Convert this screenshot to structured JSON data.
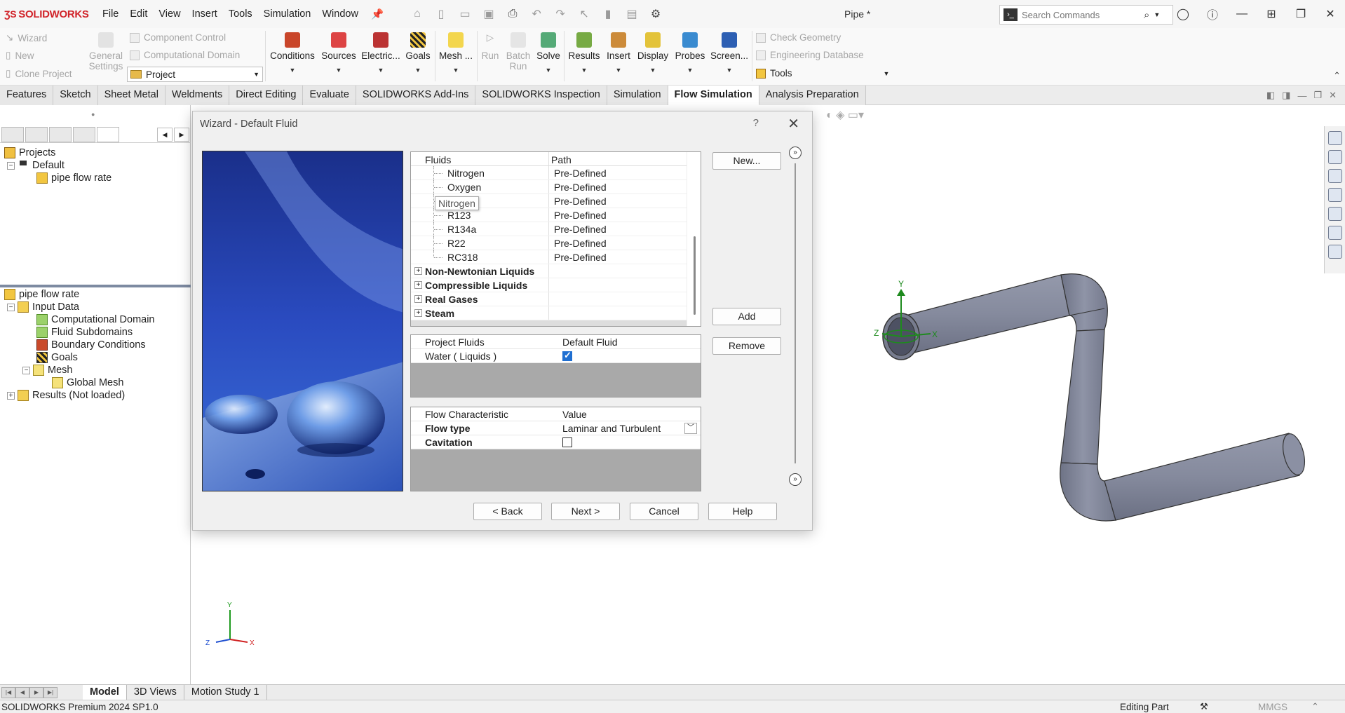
{
  "app": {
    "name": "SOLIDWORKS",
    "doc_title": "Pipe *"
  },
  "menu": [
    "File",
    "Edit",
    "View",
    "Insert",
    "Tools",
    "Simulation",
    "Window"
  ],
  "search": {
    "placeholder": "Search Commands"
  },
  "cmdmgr": {
    "wizard": "Wizard",
    "new": "New",
    "clone": "Clone Project",
    "general1": "General",
    "general2": "Settings",
    "comp_control": "Component Control",
    "comp_domain": "Computational Domain",
    "project_value": "Project",
    "conditions": "Conditions",
    "sources": "Sources",
    "electric": "Electric...",
    "goals": "Goals",
    "mesh": "Mesh ...",
    "run": "Run",
    "batch1": "Batch",
    "batch2": "Run",
    "solve": "Solve",
    "results": "Results",
    "insert": "Insert",
    "display": "Display",
    "probes": "Probes",
    "screen": "Screen...",
    "check_geometry": "Check Geometry",
    "eng_db": "Engineering Database",
    "tools": "Tools"
  },
  "tabs": [
    "Features",
    "Sketch",
    "Sheet Metal",
    "Weldments",
    "Direct Editing",
    "Evaluate",
    "SOLIDWORKS Add-Ins",
    "SOLIDWORKS Inspection",
    "Simulation",
    "Flow Simulation",
    "Analysis Preparation"
  ],
  "projects_tree": {
    "root": "Projects",
    "default": "Default",
    "item": "pipe flow rate"
  },
  "analysis_tree": {
    "root": "pipe flow rate",
    "input": "Input Data",
    "comp_domain": "Computational Domain",
    "fluid_sub": "Fluid Subdomains",
    "boundary": "Boundary Conditions",
    "goals": "Goals",
    "mesh": "Mesh",
    "global_mesh": "Global Mesh",
    "results": "Results (Not loaded)"
  },
  "dialog": {
    "title": "Wizard - Default Fluid",
    "help_glyph": "?",
    "fluids_header": "Fluids",
    "path_header": "Path",
    "fluids": [
      {
        "name": "Nitrogen",
        "path": "Pre-Defined"
      },
      {
        "name": "Oxygen",
        "path": "Pre-Defined"
      },
      {
        "name": "",
        "path": "Pre-Defined"
      },
      {
        "name": "R123",
        "path": "Pre-Defined"
      },
      {
        "name": "R134a",
        "path": "Pre-Defined"
      },
      {
        "name": "R22",
        "path": "Pre-Defined"
      },
      {
        "name": "RC318",
        "path": "Pre-Defined"
      }
    ],
    "groups": [
      "Non-Newtonian Liquids",
      "Compressible Liquids",
      "Real Gases",
      "Steam"
    ],
    "tooltip": "Nitrogen",
    "project_fluids_header": "Project Fluids",
    "default_fluid_header": "Default Fluid",
    "project_fluid": "Water ( Liquids )",
    "flow_char_header": "Flow Characteristic",
    "value_header": "Value",
    "flow_type_label": "Flow type",
    "flow_type_value": "Laminar and Turbulent",
    "cavitation_label": "Cavitation",
    "buttons": {
      "new": "New...",
      "add": "Add",
      "remove": "Remove",
      "back": "< Back",
      "next": "Next >",
      "cancel": "Cancel",
      "help": "Help"
    }
  },
  "triad": {
    "x": "X",
    "y": "Y",
    "z": "Z"
  },
  "bottom_tabs": [
    "Model",
    "3D Views",
    "Motion Study 1"
  ],
  "status": {
    "left": "SOLIDWORKS Premium 2024 SP1.0",
    "editing": "Editing Part",
    "units": "MMGS"
  }
}
